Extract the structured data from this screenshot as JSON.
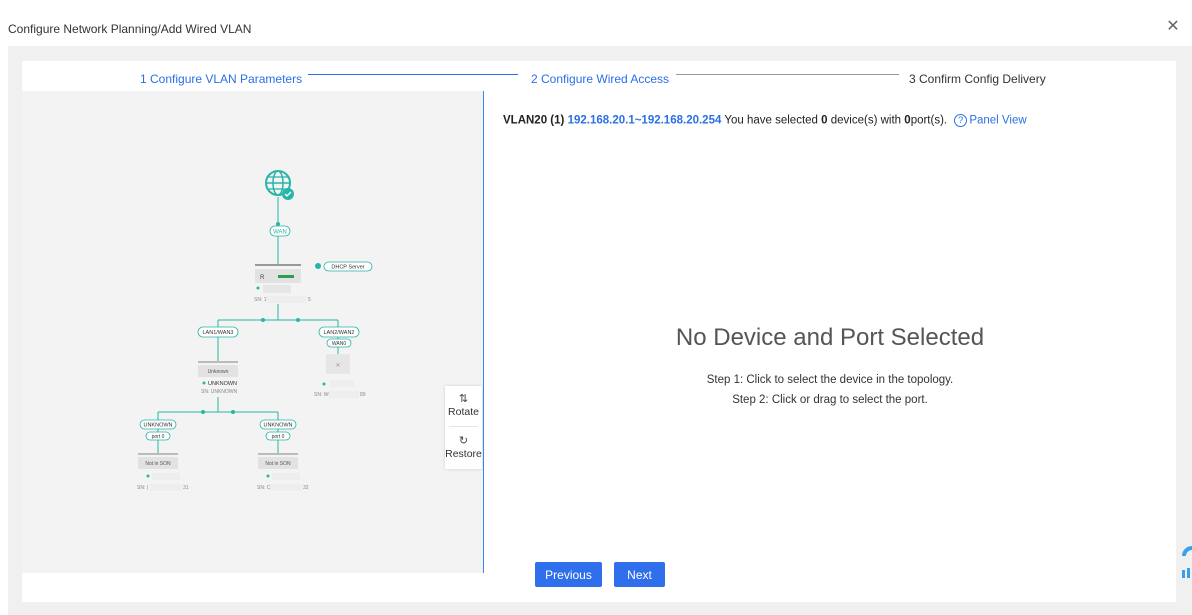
{
  "modal": {
    "title": "Configure Network Planning/Add Wired VLAN",
    "close_icon": "close-icon"
  },
  "steps": [
    {
      "label": "1 Configure VLAN Parameters",
      "state": "done"
    },
    {
      "label": "2 Configure Wired Access",
      "state": "active"
    },
    {
      "label": "3 Confirm Config Delivery",
      "state": "pending"
    }
  ],
  "summary": {
    "vlan": "VLAN20 (1)",
    "range": "192.168.20.1~192.168.20.254",
    "text1": "You have selected",
    "device_count": "0",
    "text2": "device(s) with",
    "port_count": "0",
    "text3": "port(s).",
    "panel_view": "Panel View"
  },
  "empty_state": {
    "title": "No Device and Port Selected",
    "step1": "Step 1: Click to select the device in the topology.",
    "step2": "Step 2: Click or drag to select the port."
  },
  "tools": {
    "rotate": "Rotate",
    "restore": "Restore"
  },
  "buttons": {
    "previous": "Previous",
    "next": "Next"
  },
  "topology": {
    "wan_label": "WAN",
    "dhcp_label": "DHCP Server",
    "router_letter": "R",
    "router_sn": "SN: 1",
    "router_sn_tail": "5",
    "lan1": "LAN1/WAN3",
    "lan2": "LAN2/WAN2",
    "wan0": "WAN0",
    "unknown_device_label": "Unknown",
    "unknown_status": "UNKNOWN",
    "unknown_sn": "SN: UNKNOWN",
    "ap_sn": "SN: WE",
    "ap_sn_tail": "89",
    "leaf_port_name": "UNKNOWN",
    "leaf_port": "port 0",
    "leaf_box": "Not in SON",
    "leaf1_sn": "SN: (",
    "leaf1_sn_tail": "31",
    "leaf2_sn": "SN: C",
    "leaf2_sn_tail": "32"
  },
  "colors": {
    "accent": "#2b6fe6",
    "teal": "#26b5a6",
    "button": "#2f6fec"
  }
}
